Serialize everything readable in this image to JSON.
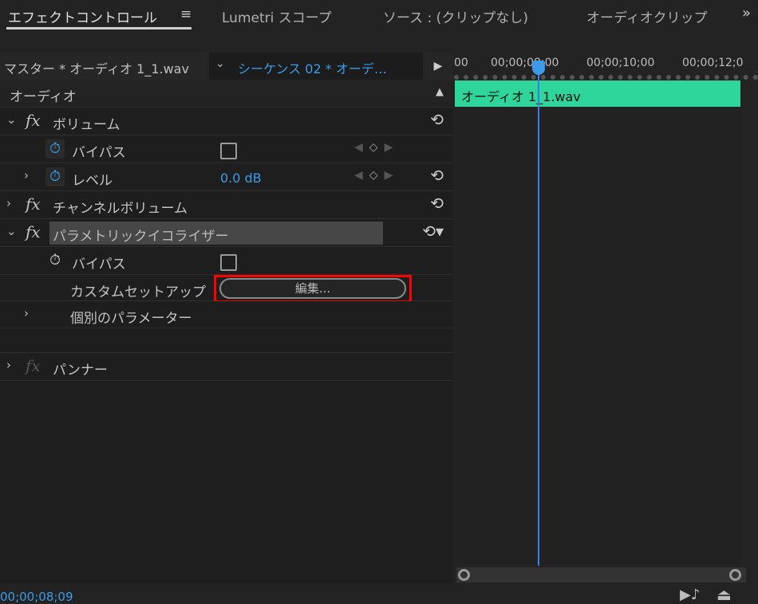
{
  "tabs": [
    {
      "label": "エフェクトコントロール",
      "active": true
    },
    {
      "label": "Lumetri スコープ"
    },
    {
      "label": "ソース : (クリップなし)"
    },
    {
      "label": "オーディオクリップ"
    }
  ],
  "tab_menu_icon": "hamburger-icon",
  "overflow_icon": "double-chevron-right-icon",
  "header": {
    "master": "マスター * オーディオ 1_1.wav",
    "sequence": "シーケンス 02 * オーデ…"
  },
  "ruler": {
    "t0": "00",
    "t1": "00;00;08;00",
    "t2": "00;00;10;00",
    "t3": "00;00;12;0"
  },
  "clip": {
    "name": "オーディオ 1_1.wav",
    "color": "#2fd69b"
  },
  "section": "オーディオ",
  "effects": {
    "volume": {
      "name": "ボリューム",
      "bypass": "バイパス",
      "level": "レベル",
      "level_value": "0.0 dB"
    },
    "channel_volume": {
      "name": "チャンネルボリューム"
    },
    "parametric_eq": {
      "name": "パラメトリックイコライザー",
      "bypass": "バイパス",
      "custom_setup": "カスタムセットアップ",
      "edit_button": "編集...",
      "individual_params": "個別のパラメーター"
    },
    "panner": {
      "name": "パンナー"
    }
  },
  "timecode": "00;00;08;09",
  "accent": "#3c9be8",
  "highlight": "#ff0000"
}
